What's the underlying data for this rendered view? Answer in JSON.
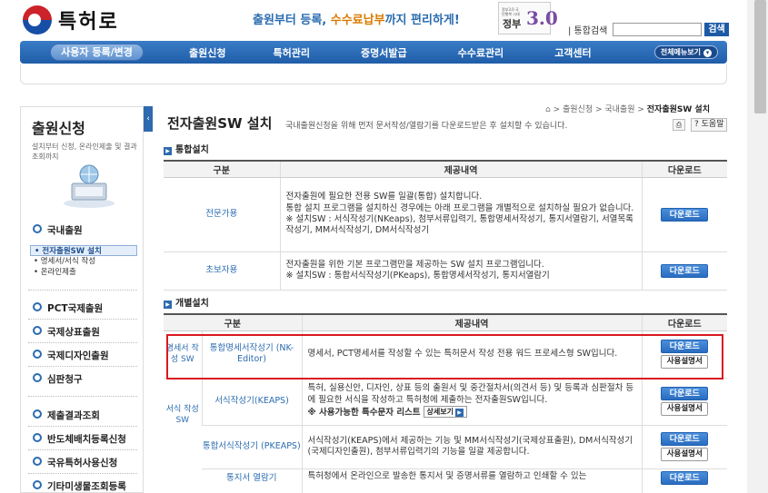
{
  "header": {
    "logo_text": "특허로",
    "slogan_a": "출원",
    "slogan_b": "부터 등록, ",
    "slogan_c": "수수료납부",
    "slogan_d": "까지 편리하게!",
    "gov_small": "정부3.0 국민행복 시대",
    "gov_big": "정부",
    "gov_num": "3.0",
    "search_label": "| 통합검색",
    "search_value": "",
    "search_button": "검색"
  },
  "nav": {
    "items": [
      "사용자 등록/변경",
      "출원신청",
      "특허관리",
      "증명서발급",
      "수수료관리",
      "고객센터"
    ],
    "all_menu": "전체메뉴보기"
  },
  "sidebar": {
    "title": "출원신청",
    "desc": "설치부터 신청, 온라인제출 및 결과조회까지",
    "toggle": "‹",
    "groups": [
      {
        "label": "국내출원",
        "sub": [
          "전자출원SW 설치",
          "명세서/서식 작성",
          "온라인제출"
        ]
      },
      {
        "label": "PCT국제출원"
      },
      {
        "label": "국제상표출원"
      },
      {
        "label": "국제디자인출원"
      },
      {
        "label": "심판청구"
      },
      {
        "label": "제출결과조회"
      },
      {
        "label": "반도체배치등록신청"
      },
      {
        "label": "국유특허사용신청"
      },
      {
        "label": "기타미생물조회등록"
      }
    ]
  },
  "page": {
    "title": "전자출원SW 설치",
    "desc": "국내출원신청을 위해 먼저 문서작성/열람기를 다운로드받은 후 설치할 수 있습니다.",
    "breadcrumb": {
      "home": "⌂",
      "sep": " > ",
      "l1": "출원신청",
      "l2": "국내출원",
      "l3": "전자출원SW 설치"
    },
    "print": "⎙",
    "help": "? 도움말"
  },
  "section1": {
    "title": "통합설치",
    "headers": [
      "구분",
      "제공내역",
      "다운로드"
    ],
    "rows": [
      {
        "kind": "전문가용",
        "desc": [
          "전자출원에 필요한 전용 SW를 일괄(통합) 설치합니다.",
          "통합 설치 프로그램을 설치하신 경우에는 아래 프로그램을 개별적으로 설치하실 필요가 없습니다.",
          "※ 설치SW : 서식작성기(NKeaps), 첨부서류입력기, 통합명세서작성기, 통지서열람기, 서열목록작성기, MM서식작성기, DM서식작성기"
        ],
        "download": "다운로드"
      },
      {
        "kind": "초보자용",
        "desc": [
          "전자출원을 위한 기본 프로그램만을 제공하는 SW 설치 프로그램입니다.",
          "※ 설치SW : 통합서식작성기(PKeaps), 통합명세서작성기, 통지서열람기"
        ],
        "download": "다운로드"
      }
    ]
  },
  "section2": {
    "title": "개별설치",
    "headers": [
      "구분",
      "제공내역",
      "다운로드"
    ],
    "rows": [
      {
        "group": "명세서 작성 SW",
        "program": "통합명세서작성기 (NK-Editor)",
        "desc": "명세서, PCT명세서를 작성할 수 있는 특허문서 작성 전용 워드 프로세스형 SW입니다.",
        "download": "다운로드",
        "manual": "사용설명서"
      },
      {
        "group": "서식 작성 SW",
        "program": "서식작성기(KEAPS)",
        "desc": "특허, 실용신안, 디자인, 상표 등의 출원서 및 중간절차서(의견서 등) 및 등록과 심판절차 등에 필요한 서식을 작성하고 특허청에 제출하는 전자출원SW입니다.",
        "note": "※ 사용가능한 특수문자 리스트",
        "detail": "상세보기",
        "download": "다운로드",
        "manual": "사용설명서"
      },
      {
        "program": "통합서식작성기 (PKEAPS)",
        "desc": "서식작성기(KEAPS)에서 제공하는 기능 및 MM서식작성기(국제상표출원), DM서식작성기(국제디자인출원), 첨부서류입력기의 기능을 일괄 제공합니다.",
        "download": "다운로드",
        "manual": "사용설명서"
      },
      {
        "program": "통지서 열람기",
        "desc": "특허청에서 온라인으로 발송한 통지서 및 증명서류를 열람하고 인쇄할 수 있는",
        "download": "다운로드"
      }
    ]
  },
  "colors": {
    "nav_blue": "#1f5da8",
    "link_blue": "#2b6cb0",
    "highlight_red": "#d9191f"
  }
}
